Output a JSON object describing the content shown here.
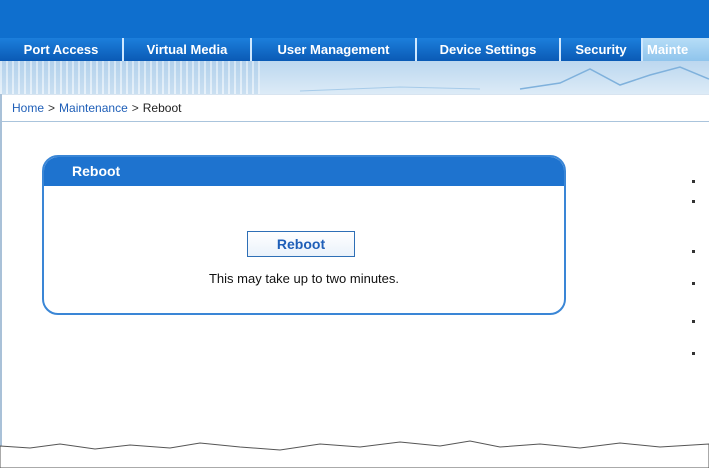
{
  "nav": {
    "tabs": [
      {
        "label": "Port Access",
        "active": false
      },
      {
        "label": "Virtual Media",
        "active": false
      },
      {
        "label": "User Management",
        "active": false
      },
      {
        "label": "Device Settings",
        "active": false
      },
      {
        "label": "Security",
        "active": false
      },
      {
        "label": "Mainte",
        "active": true
      }
    ]
  },
  "breadcrumb": {
    "home": "Home",
    "separator": ">",
    "section": "Maintenance",
    "current": "Reboot"
  },
  "panel": {
    "title": "Reboot",
    "button_label": "Reboot",
    "note": "This may take up to two minutes."
  },
  "colors": {
    "brand_blue": "#0f6fce",
    "panel_header": "#1e73cf",
    "link": "#1f5fb8"
  }
}
